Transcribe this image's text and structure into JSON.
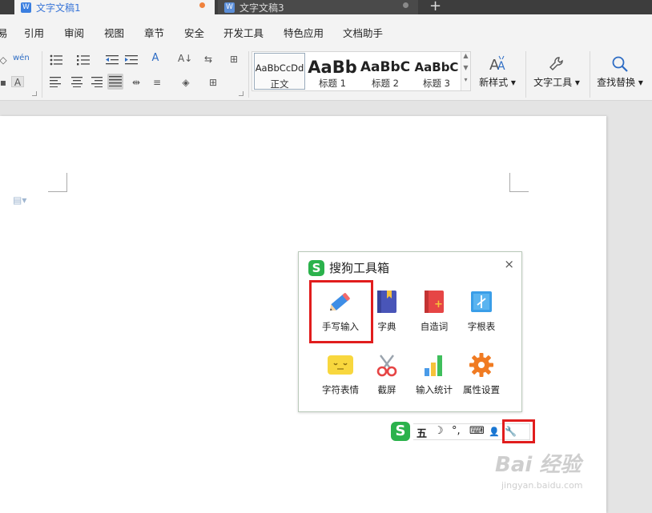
{
  "tabs": [
    {
      "label": "文字文稿1",
      "icon": "wps-writer-icon"
    },
    {
      "label": "文字文稿3",
      "icon": "wps-writer-icon"
    }
  ],
  "new_tab_label": "+",
  "menu": [
    "易",
    "引用",
    "审阅",
    "视图",
    "章节",
    "安全",
    "开发工具",
    "特色应用",
    "文档助手"
  ],
  "styles": [
    {
      "sample": "AaBbCcDd",
      "label": "正文"
    },
    {
      "sample": "AaBb",
      "label": "标题 1"
    },
    {
      "sample": "AaBbC",
      "label": "标题 2"
    },
    {
      "sample": "AaBbC",
      "label": "标题 3"
    }
  ],
  "ribbon_buttons": {
    "new_style": "新样式",
    "text_tools": "文字工具",
    "find_replace": "查找替换"
  },
  "toolbox": {
    "logo": "S",
    "title": "搜狗工具箱",
    "close": "×",
    "tools": [
      {
        "label": "手写输入",
        "icon": "pencil-icon"
      },
      {
        "label": "字典",
        "icon": "dictionary-icon"
      },
      {
        "label": "自造词",
        "icon": "custom-word-icon"
      },
      {
        "label": "字根表",
        "icon": "radical-table-icon"
      },
      {
        "label": "字符表情",
        "icon": "emoticon-icon"
      },
      {
        "label": "截屏",
        "icon": "scissors-icon"
      },
      {
        "label": "输入统计",
        "icon": "stats-icon"
      },
      {
        "label": "属性设置",
        "icon": "gear-icon"
      }
    ]
  },
  "ime_bar": {
    "logo": "S",
    "mode": "五",
    "moon": "☽",
    "punct": "°,",
    "keyboard": "⌨",
    "user": "👤",
    "wrench": "🔧"
  },
  "colors": {
    "highlight": "#e11d1d",
    "sogou_green": "#2bb24c",
    "tab_accent": "#3a76d8"
  },
  "watermark": {
    "main": "Bai 经验",
    "sub": "jingyan.baidu.com"
  }
}
